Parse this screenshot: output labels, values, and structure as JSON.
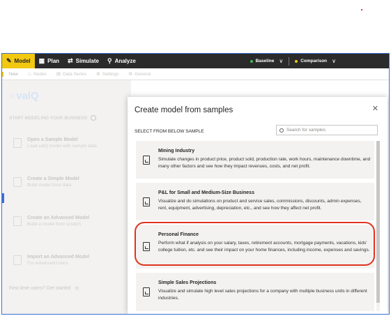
{
  "nav": {
    "tabs": [
      {
        "label": "Model",
        "icon": "pencil-icon"
      },
      {
        "label": "Plan",
        "icon": "grid-icon"
      },
      {
        "label": "Simulate",
        "icon": "simulate-icon"
      },
      {
        "label": "Analyze",
        "icon": "analyze-icon"
      }
    ],
    "scenarios": [
      {
        "label": "Baseline",
        "color": "#3fb950"
      },
      {
        "label": "Comparison",
        "color": "#f2c811"
      }
    ]
  },
  "subtoolbar": [
    "New",
    "Nodes",
    "Data Series",
    "Settings",
    "General"
  ],
  "sidebar": {
    "logo": "valQ",
    "section_title": "START MODELING YOUR BUSINESS",
    "items": [
      {
        "title": "Open a Sample Model",
        "subtitle": "Load valQ model with sample data"
      },
      {
        "title": "Create a Simple Model",
        "subtitle": "Build model from data"
      },
      {
        "title": "Create an Advanced Model",
        "subtitle": "Build a model from scratch"
      },
      {
        "title": "Import an Advanced Model",
        "subtitle": "For Advanced Users"
      }
    ],
    "first_time": "First time users? Get started"
  },
  "dialog": {
    "title": "Create model from samples",
    "subtitle": "SELECT FROM BELOW SAMPLE",
    "search_placeholder": "Search for samples",
    "close": "✕",
    "samples": [
      {
        "title": "Mining Industry",
        "description": "Simulate changes in product price, product sold, production rate, work hours, maintenance downtime, and many other factors and see how they impact revenues, costs, and net profit."
      },
      {
        "title": "P&L for Small and Medium-Size Business",
        "description": "Visualize and do simulations on product and service sales, commissions, discounts, admin expenses, rent, equipment, advertising, depreciation, etc., and see how they affect net profit."
      },
      {
        "title": "Personal Finance",
        "description": "Perform what if analysis on your salary, taxes, retirement accounts, mortgage payments, vacations, kids' college tuition, etc. and see their impact on your home finances, including income, expenses and savings."
      },
      {
        "title": "Simple Sales Projections",
        "description": "Visualize and simulate high level sales projections for a company with multiple business units in different industries."
      }
    ]
  }
}
